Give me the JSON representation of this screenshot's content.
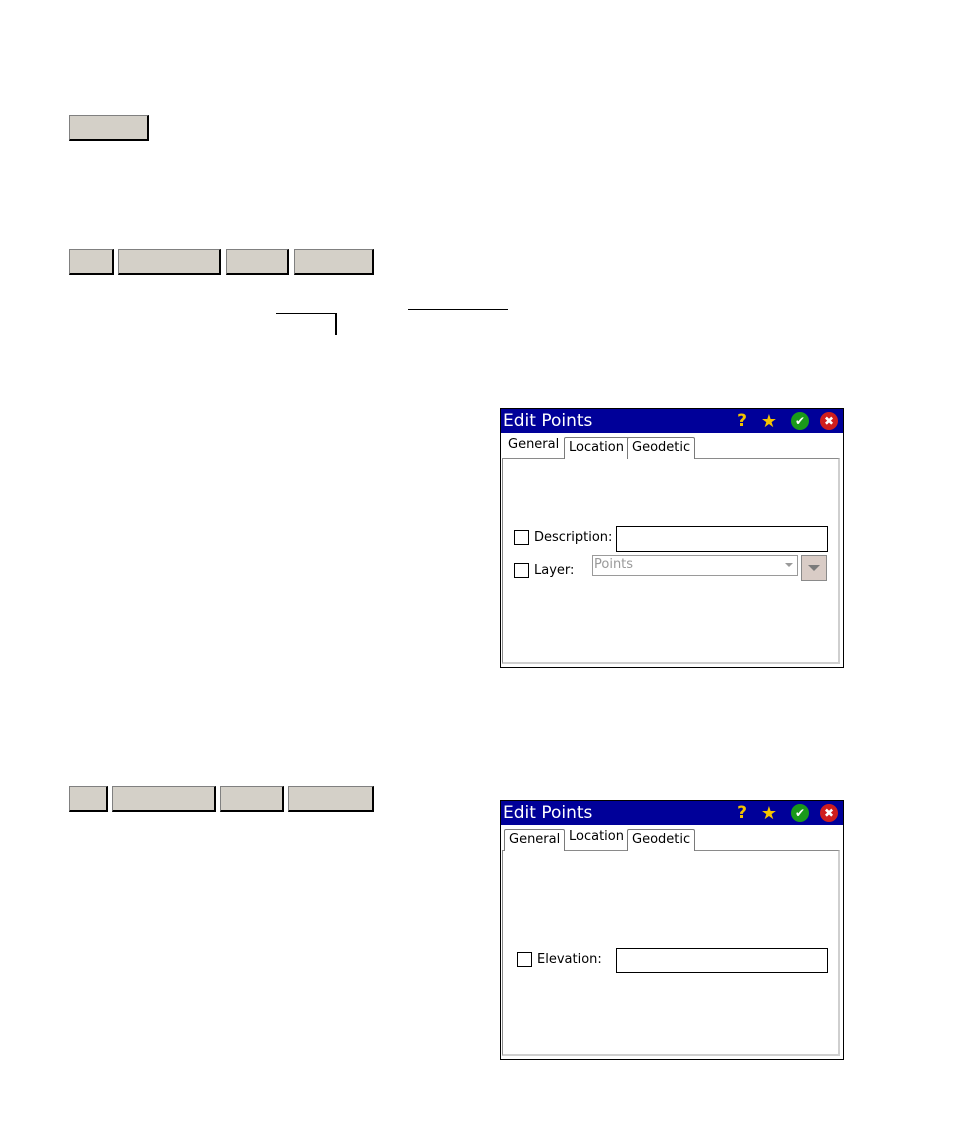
{
  "dialog_general": {
    "title": "Edit Points",
    "tabs": [
      "General",
      "Location",
      "Geodetic"
    ],
    "active_tab": "General",
    "description_label": "Description:",
    "description_value": "",
    "layer_label": "Layer:",
    "layer_value": "Points"
  },
  "dialog_location": {
    "title": "Edit Points",
    "tabs": [
      "General",
      "Location",
      "Geodetic"
    ],
    "active_tab": "Location",
    "elevation_label": "Elevation:",
    "elevation_value": ""
  },
  "icons": {
    "help": "help-icon",
    "favorite": "favorite-star-icon",
    "ok": "ok-check-icon",
    "close": "close-x-icon"
  },
  "colors": {
    "titlebar": "#000099",
    "key_button": "#d4d0c8",
    "ok": "#1a9a1a",
    "close": "#d01e1e"
  }
}
